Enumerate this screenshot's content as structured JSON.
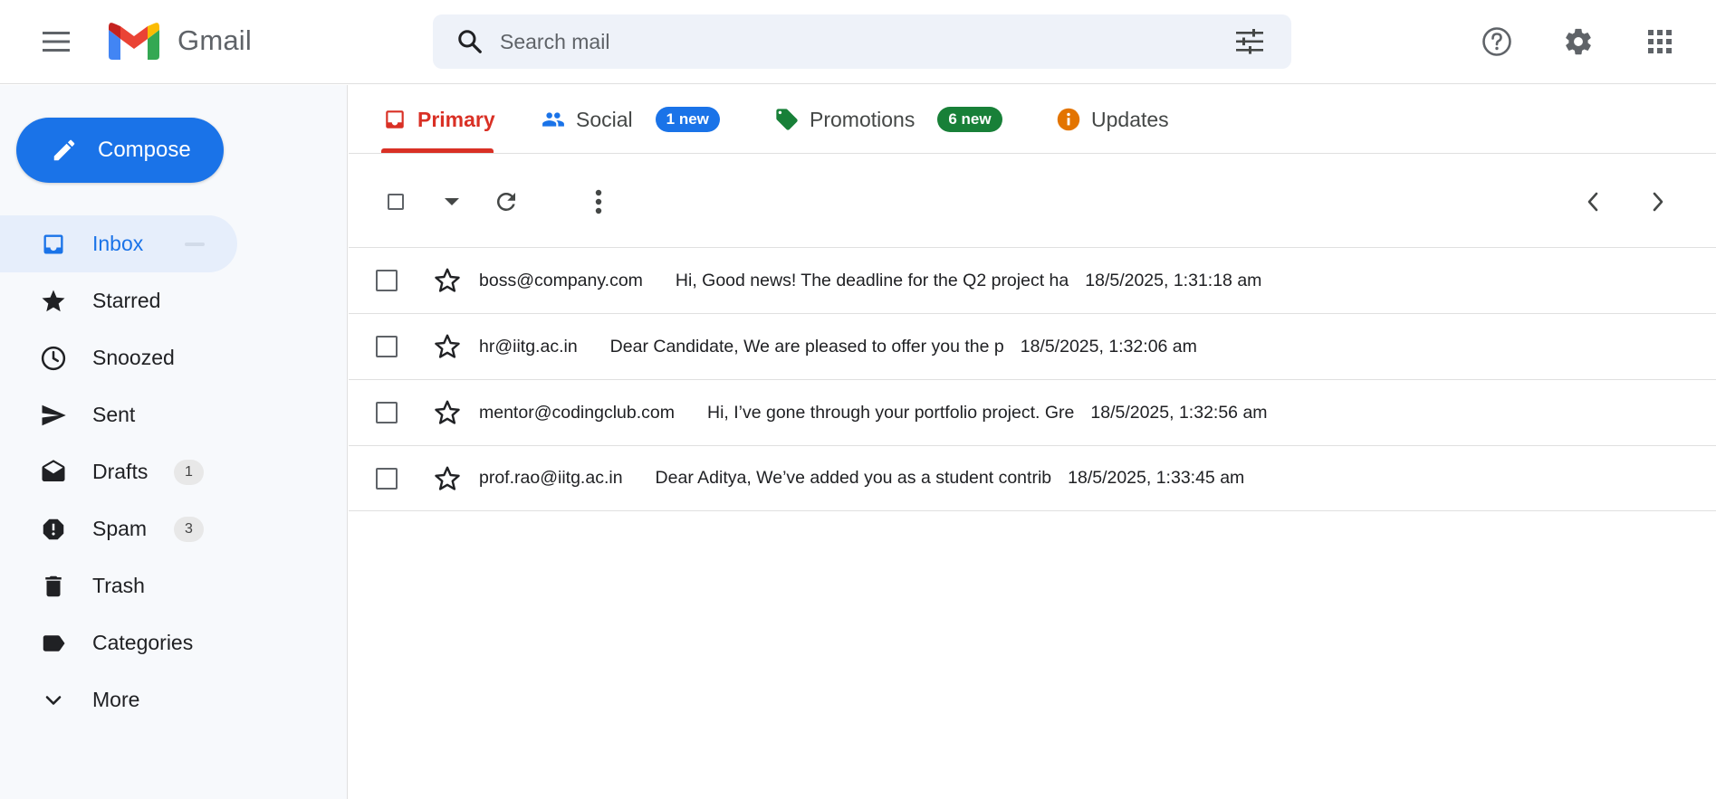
{
  "header": {
    "app_name": "Gmail",
    "search_placeholder": "Search mail",
    "icons": [
      "menu-icon",
      "gmail-logo",
      "search-icon",
      "filter-icon",
      "help-icon",
      "settings-icon",
      "apps-icon"
    ]
  },
  "sidebar": {
    "compose_label": "Compose",
    "items": [
      {
        "label": "Inbox",
        "icon": "inbox-icon",
        "count": ""
      },
      {
        "label": "Starred",
        "icon": "star-icon",
        "count": ""
      },
      {
        "label": "Snoozed",
        "icon": "clock-icon",
        "count": ""
      },
      {
        "label": "Sent",
        "icon": "send-icon",
        "count": ""
      },
      {
        "label": "Drafts",
        "icon": "draft-icon",
        "count": "1"
      },
      {
        "label": "Spam",
        "icon": "spam-icon",
        "count": "3"
      },
      {
        "label": "Trash",
        "icon": "trash-icon",
        "count": ""
      },
      {
        "label": "Categories",
        "icon": "label-icon",
        "count": ""
      },
      {
        "label": "More",
        "icon": "chevron-down-icon",
        "count": ""
      }
    ]
  },
  "tabs": [
    {
      "label": "Primary",
      "icon": "inbox-icon",
      "badge": ""
    },
    {
      "label": "Social",
      "icon": "people-icon",
      "badge": "1 new"
    },
    {
      "label": "Promotions",
      "icon": "tag-icon",
      "badge": "6 new"
    },
    {
      "label": "Updates",
      "icon": "info-icon",
      "badge": ""
    }
  ],
  "emails": [
    {
      "sender": "boss@company.com",
      "snippet": "Hi, Good news! The deadline for the Q2 project ha",
      "date": "18/5/2025, 1:31:18 am"
    },
    {
      "sender": "hr@iitg.ac.in",
      "snippet": "Dear Candidate, We are pleased to offer you the p",
      "date": "18/5/2025, 1:32:06 am"
    },
    {
      "sender": "mentor@codingclub.com",
      "snippet": "Hi, I’ve gone through your portfolio project. Gre",
      "date": "18/5/2025, 1:32:56 am"
    },
    {
      "sender": "prof.rao@iitg.ac.in",
      "snippet": "Dear Aditya, We’ve added you as a student contrib",
      "date": "18/5/2025, 1:33:45 am"
    }
  ],
  "colors": {
    "accent": "#1a73e8",
    "primary_tab": "#d93025",
    "social_badge": "#1a73e8",
    "promotions_badge": "#188038",
    "updates_icon": "#e37400"
  }
}
